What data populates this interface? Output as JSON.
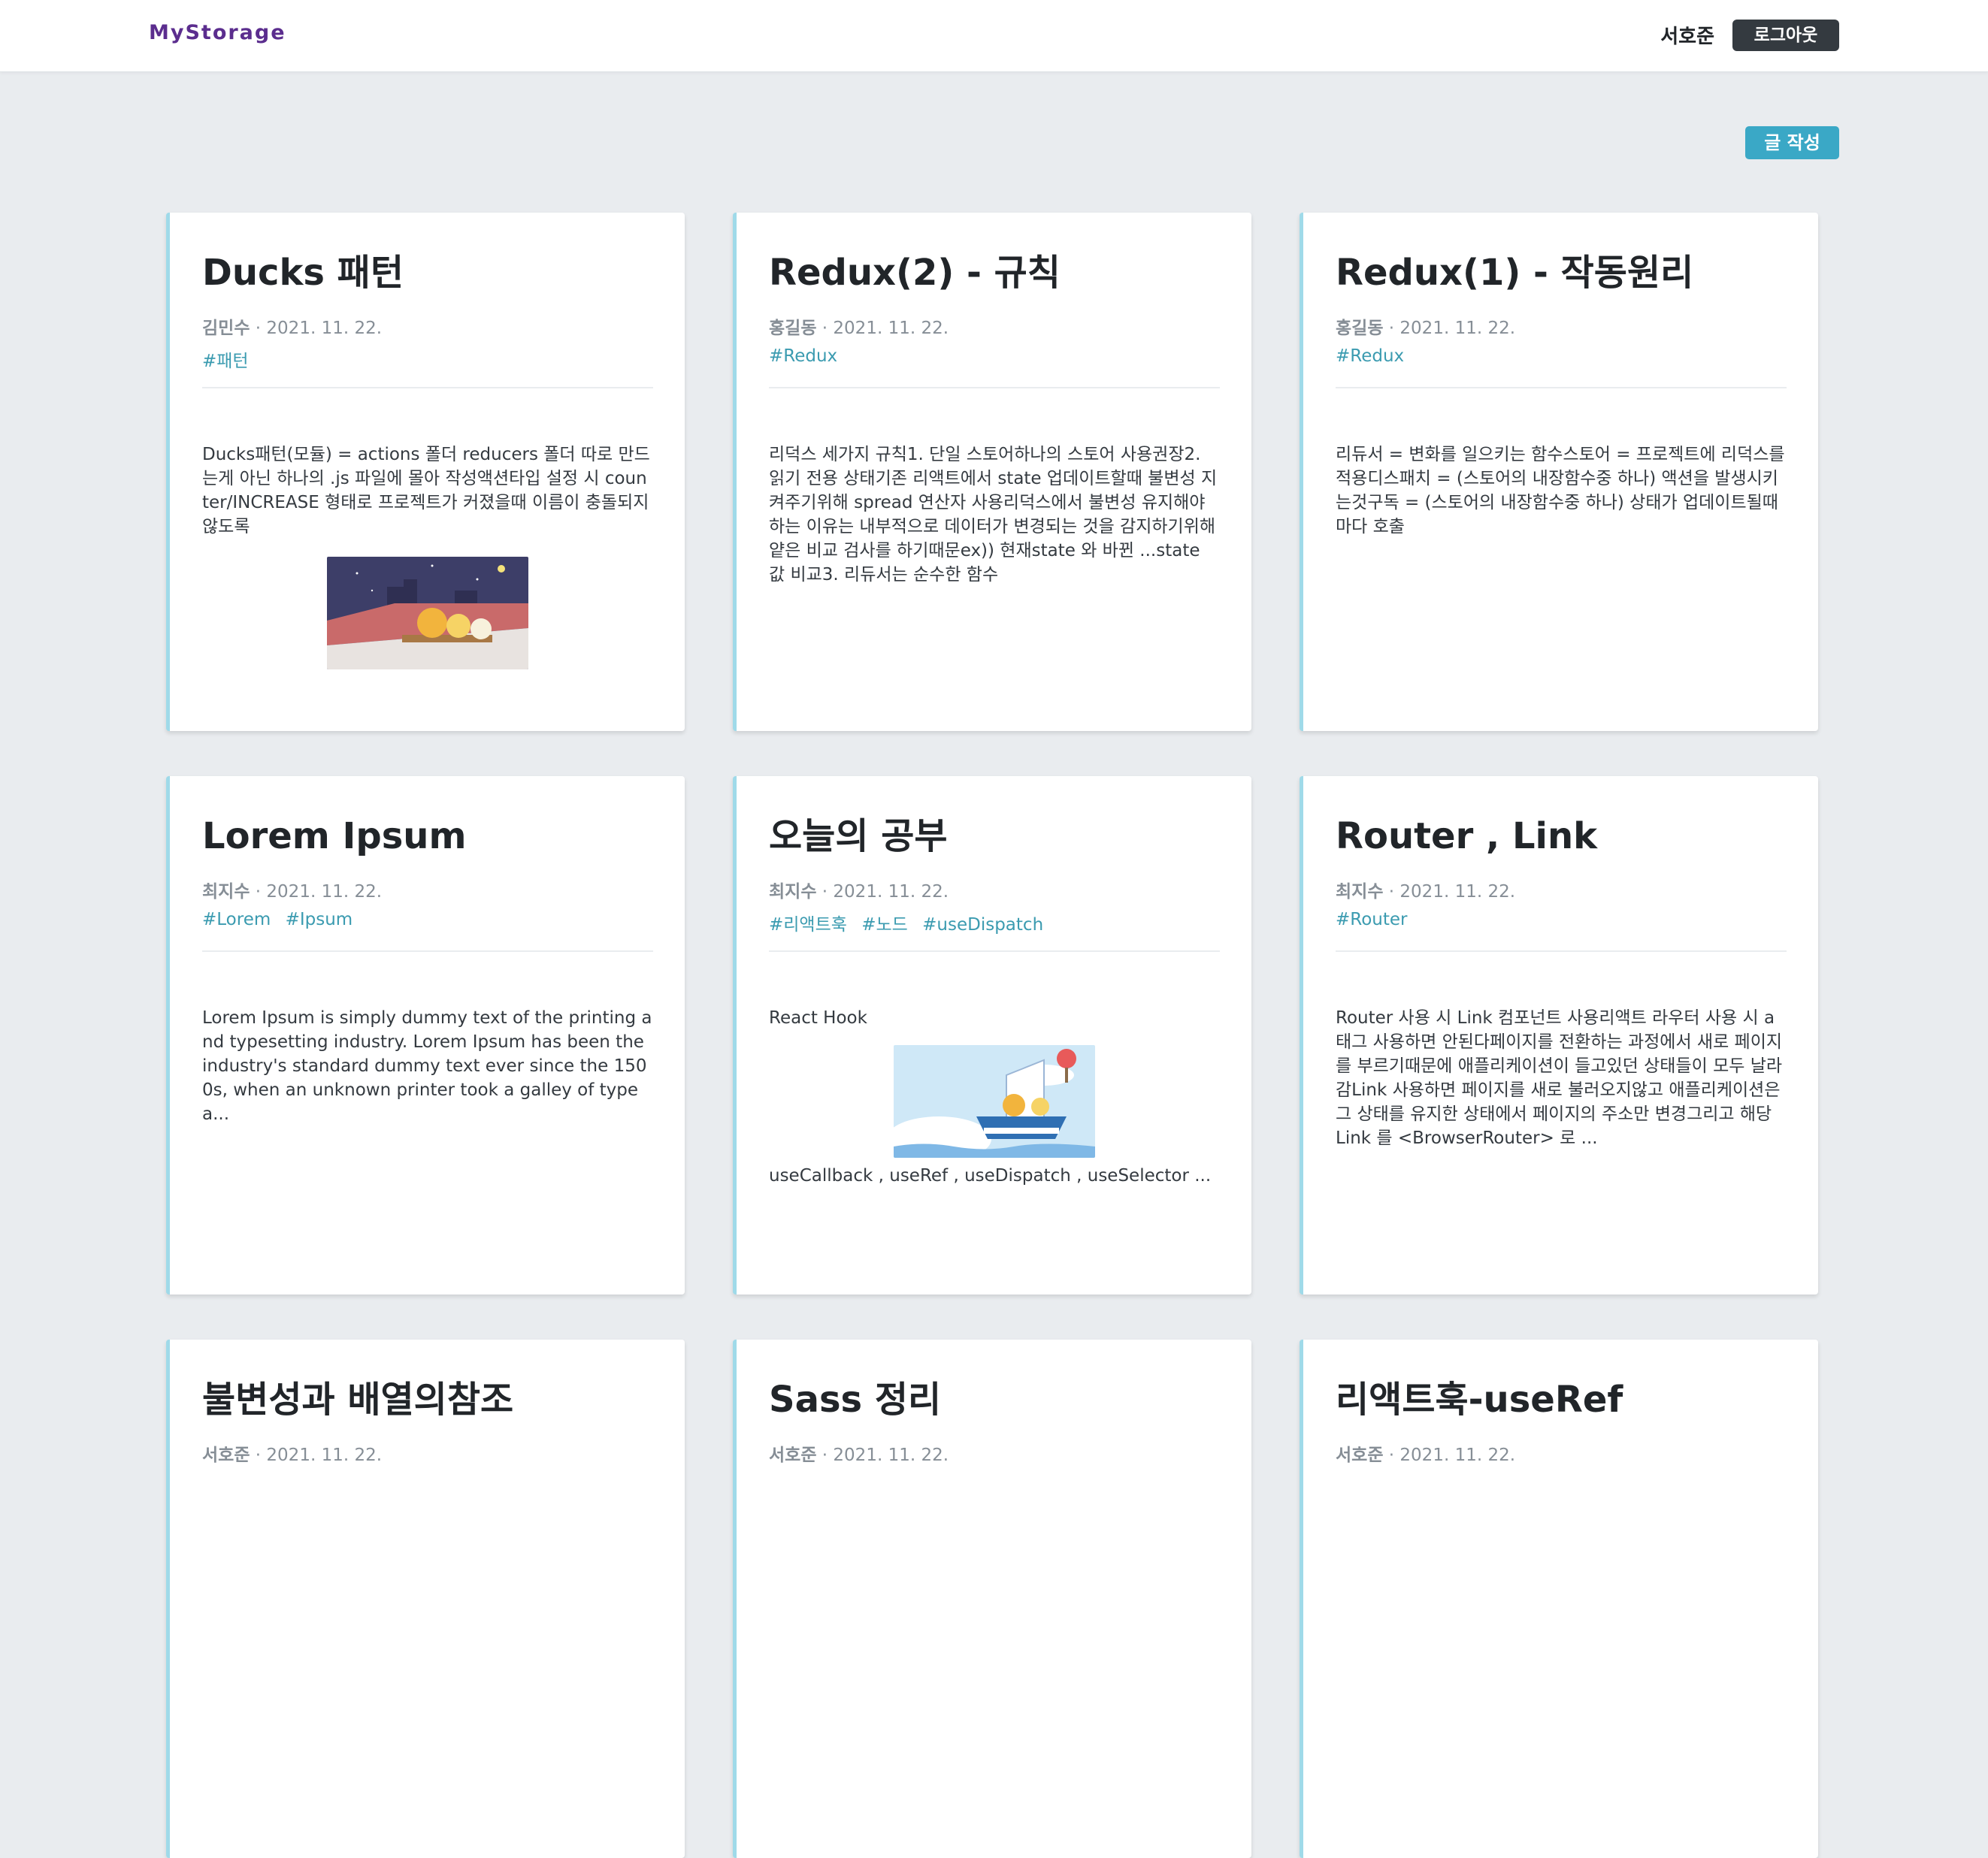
{
  "header": {
    "logo": "MyStorage",
    "user_name": "서호준",
    "logout_label": "로그아웃"
  },
  "toolbar": {
    "write_label": "글 작성"
  },
  "colors": {
    "brand": "#5b2d8e",
    "accent": "#3aa8c6",
    "card_border": "#9fdae9",
    "tag": "#3b9bb0",
    "background": "#e9ecef"
  },
  "posts": [
    {
      "title": "Ducks 패턴",
      "author": "김민수",
      "date": "· 2021. 11. 22.",
      "tags": [
        "#패턴"
      ],
      "text": "Ducks패턴(모듈) = actions 폴더 reducers 폴더 따로 만드는게 아닌 하나의 .js 파일에 몰아 작성액션타입 설정 시 counter/INCREASE 형태로 프로젝트가 커졌을때 이름이 충돌되지 않도록",
      "image": "kakao-friends-night-illustration"
    },
    {
      "title": "Redux(2) - 규칙",
      "author": "홍길동",
      "date": "· 2021. 11. 22.",
      "tags": [
        "#Redux"
      ],
      "text": "리덕스 세가지 규칙1. 단일 스토어하나의 스토어 사용권장2. 읽기 전용 상태기존 리액트에서 state 업데이트할때 불변성 지켜주기위해 spread 연산자 사용리덕스에서 불변성 유지해야하는 이유는 내부적으로 데이터가 변경되는 것을 감지하기위해 얕은 비교 검사를 하기때문ex)) 현재state 와 바뀐 ...state 값 비교3. 리듀서는 순수한 함수"
    },
    {
      "title": "Redux(1) - 작동원리",
      "author": "홍길동",
      "date": "· 2021. 11. 22.",
      "tags": [
        "#Redux"
      ],
      "text": "리듀서 = 변화를 일으키는 함수스토어 = 프로젝트에 리덕스를 적용디스패치 = (스토어의 내장함수중 하나) 액션을 발생시키는것구독 = (스토어의 내장함수중 하나) 상태가 업데이트될때마다 호출"
    },
    {
      "title": "Lorem Ipsum",
      "author": "최지수",
      "date": "· 2021. 11. 22.",
      "tags": [
        "#Lorem",
        "#Ipsum"
      ],
      "text": "Lorem Ipsum is simply dummy text of the printing and typesetting industry. Lorem Ipsum has been the industry's standard dummy text ever since the 1500s, when an unknown printer took a galley of type a..."
    },
    {
      "title": "오늘의 공부",
      "author": "최지수",
      "date": "· 2021. 11. 22.",
      "tags": [
        "#리액트훅",
        "#노드",
        "#useDispatch"
      ],
      "text": "React Hook",
      "image": "kakao-friends-boat-illustration",
      "text_after": "useCallback , useRef , useDispatch , useSelector ..."
    },
    {
      "title": "Router , Link",
      "author": "최지수",
      "date": "· 2021. 11. 22.",
      "tags": [
        "#Router"
      ],
      "text": "Router 사용 시 Link 컴포넌트 사용리액트 라우터 사용 시 a태그 사용하면 안된다페이지를 전환하는 과정에서 새로 페이지를 부르기때문에 애플리케이션이 들고있던 상태들이 모두 날라감Link 사용하면 페이지를 새로 불러오지않고 애플리케이션은 그 상태를 유지한 상태에서 페이지의 주소만 변경그리고 해당 Link 를 <BrowserRouter> 로 ..."
    },
    {
      "title": "불변성과 배열의참조",
      "author": "서호준",
      "date": "· 2021. 11. 22.",
      "tags": [],
      "text": ""
    },
    {
      "title": "Sass 정리",
      "author": "서호준",
      "date": "· 2021. 11. 22.",
      "tags": [],
      "text": ""
    },
    {
      "title": "리액트훅-useRef",
      "author": "서호준",
      "date": "· 2021. 11. 22.",
      "tags": [],
      "text": ""
    }
  ]
}
